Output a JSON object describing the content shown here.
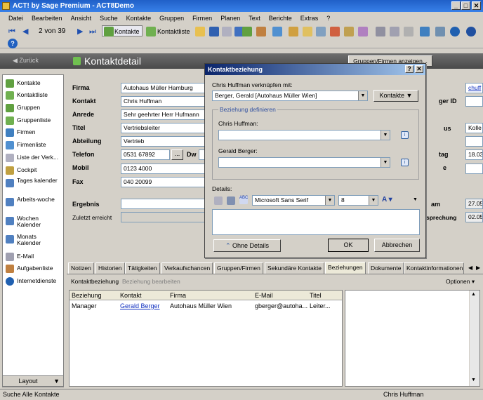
{
  "window": {
    "title": "ACT! by Sage Premium - ACT8Demo"
  },
  "menu": [
    "Datei",
    "Bearbeiten",
    "Ansicht",
    "Suche",
    "Kontakte",
    "Gruppen",
    "Firmen",
    "Planen",
    "Text",
    "Berichte",
    "Extras",
    "?"
  ],
  "toolbar": {
    "record_counter": "2 von 39",
    "contacts_label": "Kontakte",
    "contactlist_label": "Kontaktliste"
  },
  "nav": {
    "back_label": "Zurück",
    "page_title": "Kontaktdetail",
    "group_firm_button": "Gruppen/Firmen anzeigen..."
  },
  "sidebar": {
    "items": [
      "Kontakte",
      "Kontaktliste",
      "Gruppen",
      "Gruppenliste",
      "Firmen",
      "Firmenliste",
      "Liste der Verk...",
      "Cockpit",
      "Tages kalender",
      "Arbeits-woche",
      "Wochen Kalender",
      "Monats Kalender",
      "E-Mail",
      "Aufgabenliste",
      "Internetdienste"
    ],
    "layout_label": "Layout"
  },
  "detail": {
    "labels": {
      "firma": "Firma",
      "kontakt": "Kontakt",
      "anrede": "Anrede",
      "titel": "Titel",
      "abteilung": "Abteilung",
      "telefon": "Telefon",
      "mobil": "Mobil",
      "fax": "Fax",
      "ergebnis": "Ergebnis",
      "zuletzt": "Zuletzt erreicht",
      "dw": "Dw"
    },
    "values": {
      "firma": "Autohaus Müller Hamburg",
      "kontakt": "Chris Huffman",
      "anrede": "Sehr geehrter Herr Hufmann",
      "titel": "Vertriebsleiter",
      "abteilung": "Vertrieb",
      "telefon": "0531 67892",
      "mobil": "0123 4000",
      "fax": "040 20099"
    },
    "right_labels": [
      "ger ID",
      "us",
      "tag",
      "am",
      "sprechung"
    ],
    "right_values": [
      "chuff",
      "Kolle",
      "18.03",
      "27.05",
      "02.05"
    ]
  },
  "tabs": [
    "Notizen",
    "Historien",
    "Tätigkeiten",
    "Verkaufschancen",
    "Gruppen/Firmen",
    "Sekundäre Kontakte",
    "Beziehungen",
    "Dokumente",
    "Kontaktinformationen"
  ],
  "tab_toolbar": {
    "relationship": "Kontaktbeziehung",
    "edit": "Beziehung bearbeiten",
    "options": "Optionen"
  },
  "grid": {
    "columns": [
      "Beziehung",
      "Kontakt",
      "Firma",
      "E-Mail",
      "Titel"
    ],
    "rows": [
      [
        "Manager",
        "Gerald Berger",
        "Autohaus Müller Wien",
        "gberger@autoha...",
        "Leiter..."
      ]
    ]
  },
  "statusbar": {
    "left": "Suche Alle Kontakte",
    "right": "Chris Huffman"
  },
  "dialog": {
    "title": "Kontaktbeziehung",
    "link_label": "Chris Huffman verknüpfen mit:",
    "link_value": "Berger, Gerald [Autohaus Müller Wien]",
    "contacts_btn": "Kontakte",
    "group_title": "Beziehung definieren",
    "person1_label": "Chris Huffman:",
    "person2_label": "Gerald Berger:",
    "details_label": "Details:",
    "font": "Microsoft Sans Serif",
    "font_size": "8",
    "less_btn": "Ohne Details",
    "ok": "OK",
    "cancel": "Abbrechen"
  }
}
